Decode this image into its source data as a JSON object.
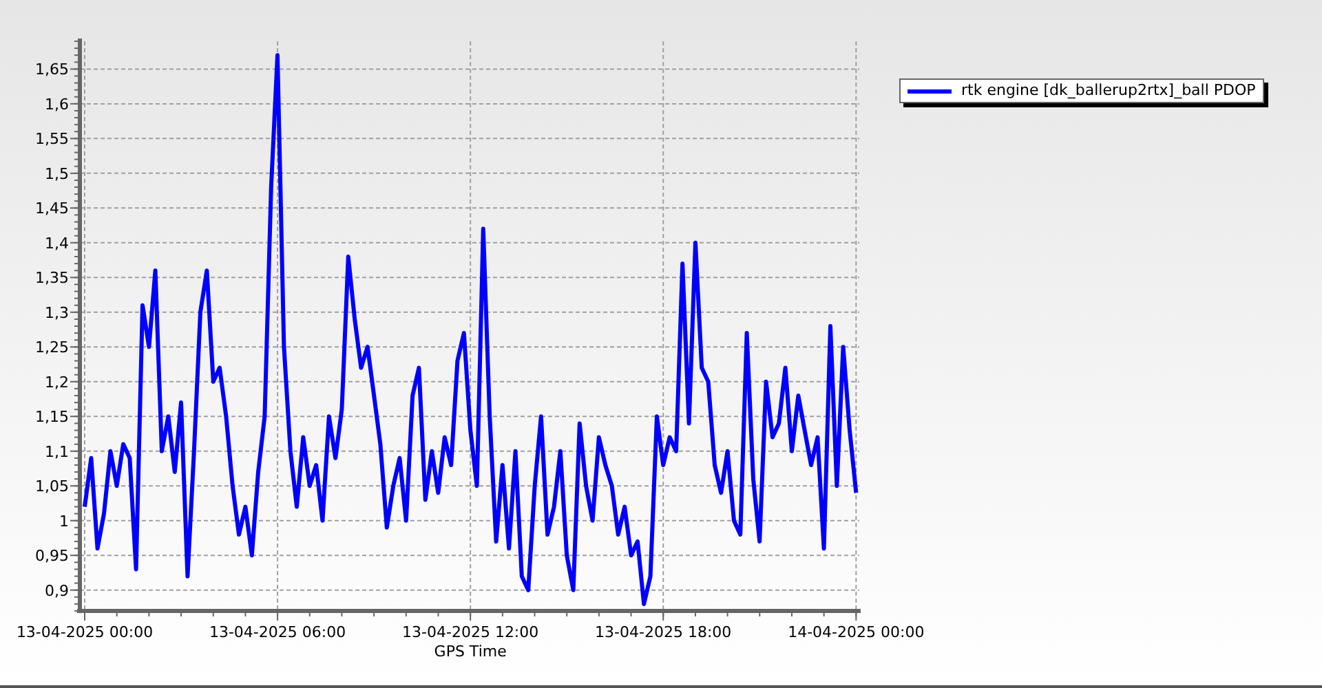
{
  "chart": {
    "chart_data": {
      "type": "line",
      "xlabel": "GPS Time",
      "grid": true,
      "ylim": [
        0.87,
        1.69
      ],
      "yticks": [
        {
          "value": 0.9,
          "label": "0,9"
        },
        {
          "value": 0.95,
          "label": "0,95"
        },
        {
          "value": 1,
          "label": "1"
        },
        {
          "value": 1.05,
          "label": "1,05"
        },
        {
          "value": 1.1,
          "label": "1,1"
        },
        {
          "value": 1.15,
          "label": "1,15"
        },
        {
          "value": 1.2,
          "label": "1,2"
        },
        {
          "value": 1.25,
          "label": "1,25"
        },
        {
          "value": 1.3,
          "label": "1,3"
        },
        {
          "value": 1.35,
          "label": "1,35"
        },
        {
          "value": 1.4,
          "label": "1,4"
        },
        {
          "value": 1.45,
          "label": "1,45"
        },
        {
          "value": 1.5,
          "label": "1,5"
        },
        {
          "value": 1.55,
          "label": "1,55"
        },
        {
          "value": 1.6,
          "label": "1,6"
        },
        {
          "value": 1.65,
          "label": "1,65"
        }
      ],
      "categories": [
        "13-04-2025 00:00",
        null,
        null,
        null,
        null,
        null,
        null,
        null,
        null,
        null,
        null,
        null,
        null,
        null,
        null,
        null,
        null,
        null,
        null,
        null,
        null,
        null,
        null,
        null,
        null,
        null,
        null,
        null,
        null,
        null,
        "13-04-2025 06:00",
        null,
        null,
        null,
        null,
        null,
        null,
        null,
        null,
        null,
        null,
        null,
        null,
        null,
        null,
        null,
        null,
        null,
        null,
        null,
        null,
        null,
        null,
        null,
        null,
        null,
        null,
        null,
        null,
        null,
        "13-04-2025 12:00",
        null,
        null,
        null,
        null,
        null,
        null,
        null,
        null,
        null,
        null,
        null,
        null,
        null,
        null,
        null,
        null,
        null,
        null,
        null,
        null,
        null,
        null,
        null,
        null,
        null,
        null,
        null,
        null,
        null,
        "13-04-2025 18:00",
        null,
        null,
        null,
        null,
        null,
        null,
        null,
        null,
        null,
        null,
        null,
        null,
        null,
        null,
        null,
        null,
        null,
        null,
        null,
        null,
        null,
        null,
        null,
        null,
        null,
        null,
        null,
        null,
        null,
        "14-04-2025 00:00"
      ],
      "series": [
        {
          "name": "rtk engine [dk_ballerup2rtx]_ball PDOP",
          "color": "#0000ff",
          "values": [
            1.02,
            1.09,
            0.96,
            1.01,
            1.1,
            1.05,
            1.11,
            1.09,
            0.93,
            1.31,
            1.25,
            1.36,
            1.1,
            1.15,
            1.07,
            1.17,
            0.92,
            1.1,
            1.3,
            1.36,
            1.2,
            1.22,
            1.15,
            1.05,
            0.98,
            1.02,
            0.95,
            1.07,
            1.15,
            1.48,
            1.67,
            1.25,
            1.1,
            1.02,
            1.12,
            1.05,
            1.08,
            1.0,
            1.15,
            1.09,
            1.16,
            1.38,
            1.29,
            1.22,
            1.25,
            1.18,
            1.11,
            0.99,
            1.05,
            1.09,
            1.0,
            1.18,
            1.22,
            1.03,
            1.1,
            1.04,
            1.12,
            1.08,
            1.23,
            1.27,
            1.13,
            1.05,
            1.42,
            1.15,
            0.97,
            1.08,
            0.96,
            1.1,
            0.92,
            0.9,
            1.05,
            1.15,
            0.98,
            1.02,
            1.1,
            0.95,
            0.9,
            1.14,
            1.05,
            1.0,
            1.12,
            1.08,
            1.05,
            0.98,
            1.02,
            0.95,
            0.97,
            0.88,
            0.92,
            1.15,
            1.08,
            1.12,
            1.1,
            1.37,
            1.14,
            1.4,
            1.22,
            1.2,
            1.08,
            1.04,
            1.1,
            1.0,
            0.98,
            1.27,
            1.06,
            0.97,
            1.2,
            1.12,
            1.14,
            1.22,
            1.1,
            1.18,
            1.13,
            1.08,
            1.12,
            0.96,
            1.28,
            1.05,
            1.25,
            1.13,
            1.04
          ]
        }
      ]
    }
  }
}
